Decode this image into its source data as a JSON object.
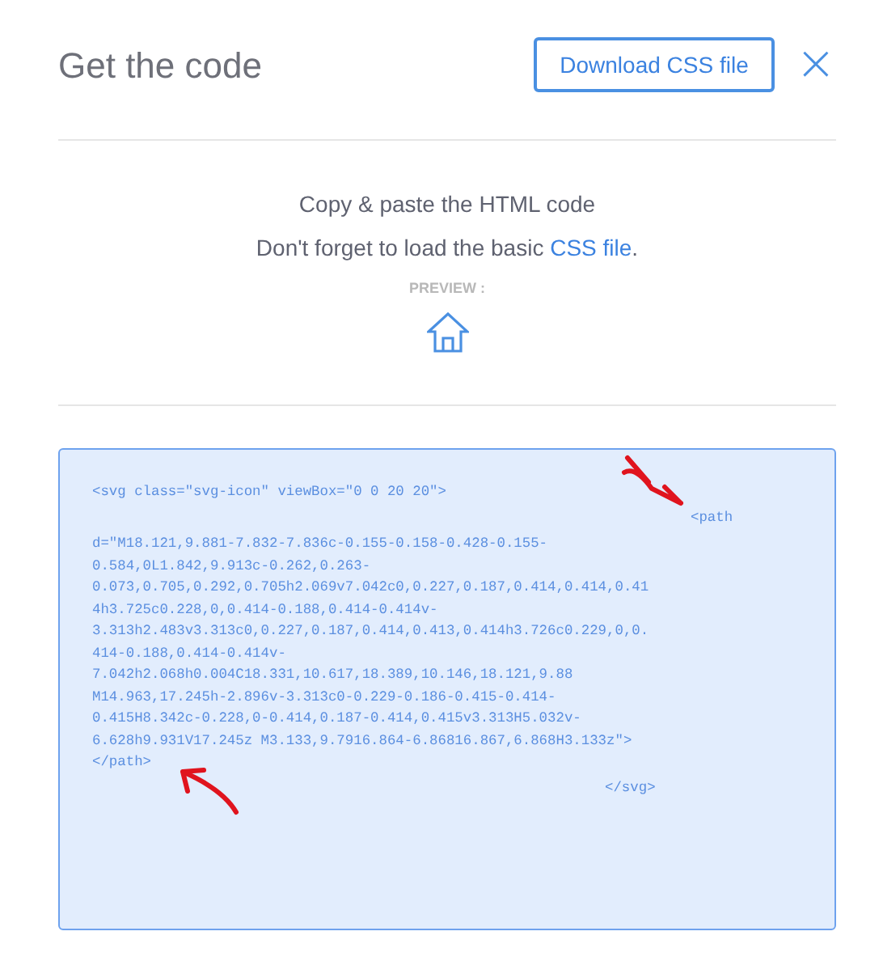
{
  "header": {
    "title": "Get the code",
    "download_button": "Download CSS file",
    "close": "×"
  },
  "instructions": {
    "line_1": "Copy & paste the HTML code",
    "line_2_before": "Don't forget to load the basic ",
    "line_2_link": "CSS file",
    "line_2_after": "."
  },
  "preview": {
    "label": "PREVIEW :"
  },
  "code": {
    "lines": [
      {
        "kind": "code",
        "text": "<svg class=\"svg-icon\" viewBox=\"0 0 20 20\">"
      },
      {
        "kind": "path-open",
        "text": "<path"
      },
      {
        "kind": "code",
        "text": "d=\"M18.121,9.881-7.832-7.836c-0.155-0.158-0.428-0.155-"
      },
      {
        "kind": "code",
        "text": "0.584,0L1.842,9.913c-0.262,0.263-"
      },
      {
        "kind": "code",
        "text": "0.073,0.705,0.292,0.705h2.069v7.042c0,0.227,0.187,0.414,0.414,0.41"
      },
      {
        "kind": "code",
        "text": "4h3.725c0.228,0,0.414-0.188,0.414-0.414v-"
      },
      {
        "kind": "code",
        "text": "3.313h2.483v3.313c0,0.227,0.187,0.414,0.413,0.414h3.726c0.229,0,0."
      },
      {
        "kind": "code",
        "text": "414-0.188,0.414-0.414v-"
      },
      {
        "kind": "code",
        "text": "7.042h2.068h0.004C18.331,10.617,18.389,10.146,18.121,9.88"
      },
      {
        "kind": "code",
        "text": "M14.963,17.245h-2.896v-3.313c0-0.229-0.186-0.415-0.414-"
      },
      {
        "kind": "code",
        "text": "0.415H8.342c-0.228,0-0.414,0.187-0.414,0.415v3.313H5.032v-"
      },
      {
        "kind": "code",
        "text": "6.628h9.931V17.245z M3.133,9.7916.864-6.86816.867,6.868H3.133z\">"
      },
      {
        "kind": "code",
        "text": "</path>"
      },
      {
        "kind": "svg-close",
        "text": "</svg>"
      }
    ]
  }
}
